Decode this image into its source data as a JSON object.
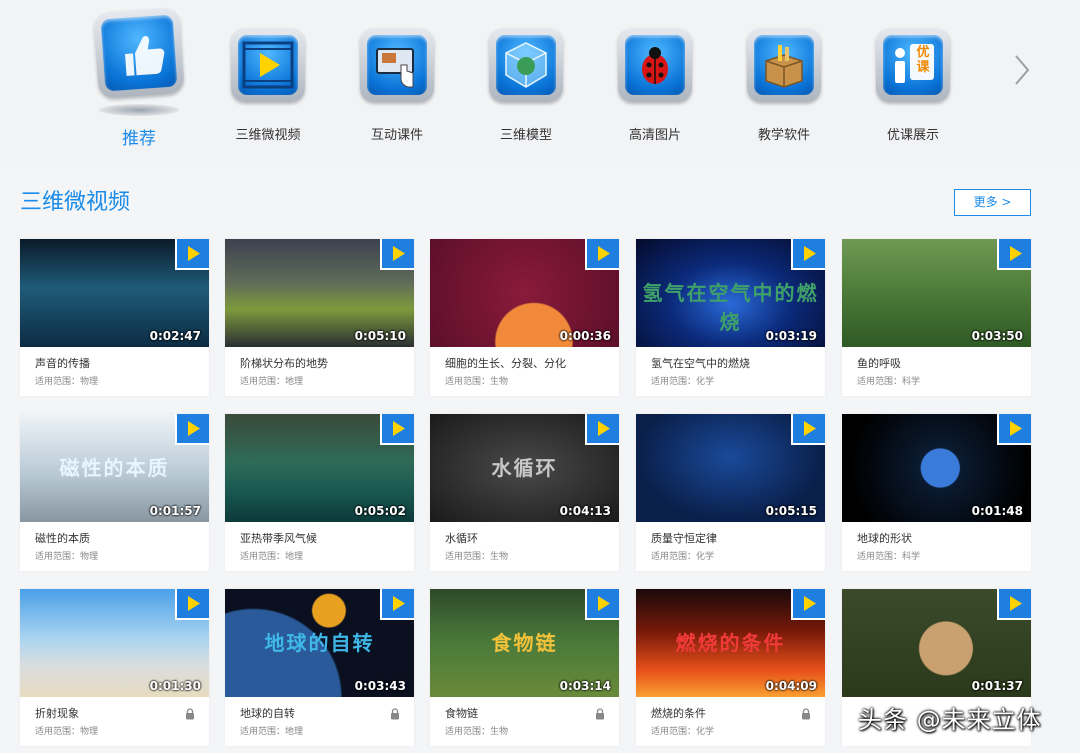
{
  "categories": [
    {
      "label": "推荐",
      "icon": "thumbs-up-icon",
      "active": true
    },
    {
      "label": "三维微视频",
      "icon": "play-icon"
    },
    {
      "label": "互动课件",
      "icon": "touch-screen-icon"
    },
    {
      "label": "三维模型",
      "icon": "cube-icon"
    },
    {
      "label": "高清图片",
      "icon": "ladybug-icon"
    },
    {
      "label": "教学软件",
      "icon": "software-box-icon"
    },
    {
      "label": "优课展示",
      "icon": "excellent-class-icon",
      "badge": "优课"
    }
  ],
  "section": {
    "title": "三维微视频",
    "more_label": "更多 >"
  },
  "videos": [
    {
      "title": "声音的传播",
      "subject": "适用范围：物理",
      "duration": "0:02:47",
      "overlay": "",
      "locked": false
    },
    {
      "title": "阶梯状分布的地势",
      "subject": "适用范围：地理",
      "duration": "0:05:10",
      "overlay": "",
      "locked": false
    },
    {
      "title": "细胞的生长、分裂、分化",
      "subject": "适用范围：生物",
      "duration": "0:00:36",
      "overlay": "",
      "locked": false
    },
    {
      "title": "氢气在空气中的燃烧",
      "subject": "适用范围：化学",
      "duration": "0:03:19",
      "overlay": "氢气在空气中的燃烧",
      "locked": false
    },
    {
      "title": "鱼的呼吸",
      "subject": "适用范围：科学",
      "duration": "0:03:50",
      "overlay": "",
      "locked": false
    },
    {
      "title": "磁性的本质",
      "subject": "适用范围：物理",
      "duration": "0:01:57",
      "overlay": "磁性的本质",
      "locked": false
    },
    {
      "title": "亚热带季风气候",
      "subject": "适用范围：地理",
      "duration": "0:05:02",
      "overlay": "",
      "locked": false
    },
    {
      "title": "水循环",
      "subject": "适用范围：生物",
      "duration": "0:04:13",
      "overlay": "水循环",
      "locked": false
    },
    {
      "title": "质量守恒定律",
      "subject": "适用范围：化学",
      "duration": "0:05:15",
      "overlay": "",
      "locked": false
    },
    {
      "title": "地球的形状",
      "subject": "适用范围：科学",
      "duration": "0:01:48",
      "overlay": "",
      "locked": false
    },
    {
      "title": "折射现象",
      "subject": "适用范围：物理",
      "duration": "0:01:30",
      "overlay": "",
      "locked": true
    },
    {
      "title": "地球的自转",
      "subject": "适用范围：地理",
      "duration": "0:03:43",
      "overlay": "地球的自转",
      "locked": true
    },
    {
      "title": "食物链",
      "subject": "适用范围：生物",
      "duration": "0:03:14",
      "overlay": "食物链",
      "locked": true
    },
    {
      "title": "燃烧的条件",
      "subject": "适用范围：化学",
      "duration": "0:04:09",
      "overlay": "燃烧的条件",
      "locked": true
    },
    {
      "title": "",
      "subject": "",
      "duration": "0:01:37",
      "overlay": "",
      "locked": false
    }
  ],
  "watermark": "头条 @未来立体",
  "colors": {
    "accent": "#1a8be8",
    "badge": "#1e7fe0"
  }
}
